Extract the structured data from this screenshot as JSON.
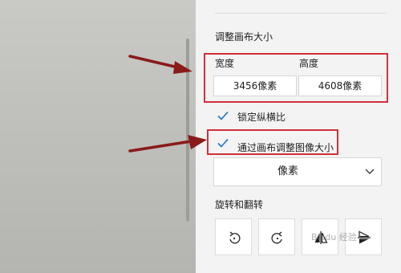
{
  "panel": {
    "section_title": "调整画布大小",
    "width_label": "宽度",
    "height_label": "高度",
    "width_value": "3456像素",
    "height_value": "4608像素",
    "lock_aspect": {
      "label": "锁定纵横比",
      "checked": true
    },
    "resize_image": {
      "label": "通过画布调整图像大小",
      "checked": true
    },
    "unit_select": {
      "value": "像素"
    },
    "rotate_title": "旋转和翻转",
    "buttons": [
      {
        "name": "rotate-left-button",
        "icon": "rotate-left-icon"
      },
      {
        "name": "rotate-right-button",
        "icon": "rotate-right-icon"
      },
      {
        "name": "flip-horizontal-button",
        "icon": "flip-horizontal-icon"
      },
      {
        "name": "flip-vertical-button",
        "icon": "flip-vertical-icon"
      }
    ]
  },
  "annotation": {
    "color": "#d1303a",
    "arrow_color": "#8b1a1a"
  },
  "watermark": "Baidu 经验"
}
